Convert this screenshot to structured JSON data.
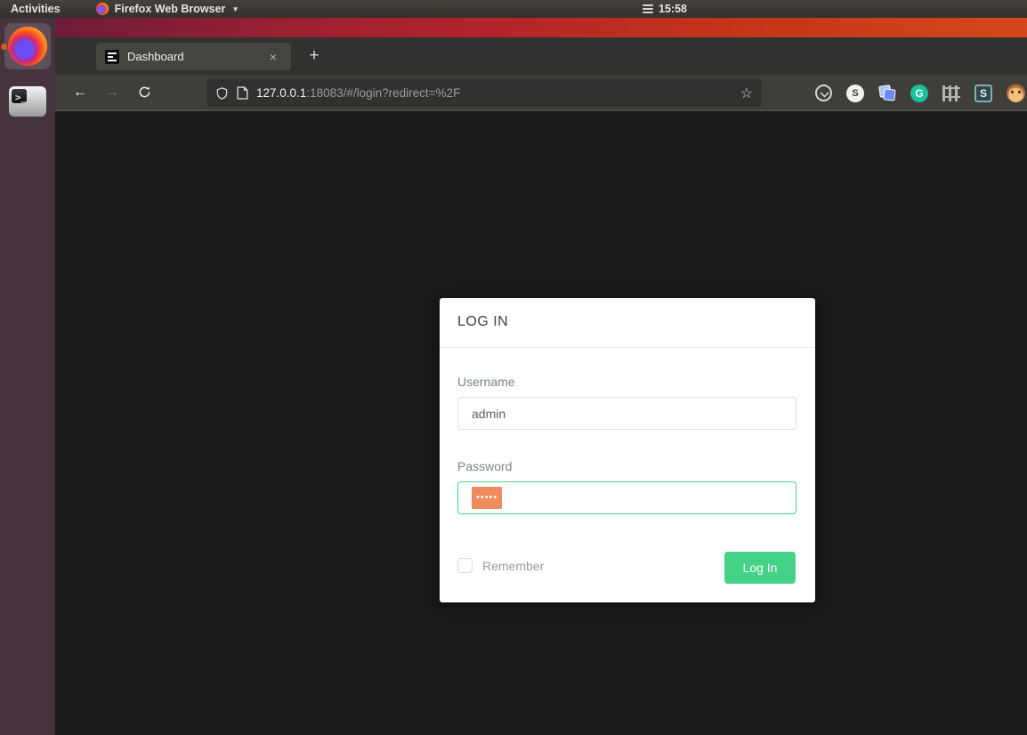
{
  "top_bar": {
    "activities": "Activities",
    "app_menu": "Firefox Web Browser",
    "time": "15:58"
  },
  "dock": {
    "terminal_glyph": ">_"
  },
  "browser": {
    "tab_title": "Dashboard",
    "close_glyph": "×",
    "new_tab_glyph": "+",
    "back_glyph": "←",
    "forward_glyph": "→",
    "url_host": "127.0.0.1",
    "url_rest": ":18083/#/login?redirect=%2F",
    "star_glyph": "☆",
    "extensions": {
      "s_circle": "S",
      "grammarly": "G",
      "stylus": "S"
    }
  },
  "login": {
    "title": "LOG IN",
    "username_label": "Username",
    "username_value": "admin",
    "password_label": "Password",
    "password_mask": "•••••",
    "remember_label": "Remember",
    "submit_label": "Log In"
  },
  "icons": {
    "dropdown": "▾"
  },
  "colors": {
    "accent_green": "#42d885",
    "button_green": "#45d287",
    "selection_orange": "#f08a5f",
    "panel_orange_dot": "#e95420"
  }
}
